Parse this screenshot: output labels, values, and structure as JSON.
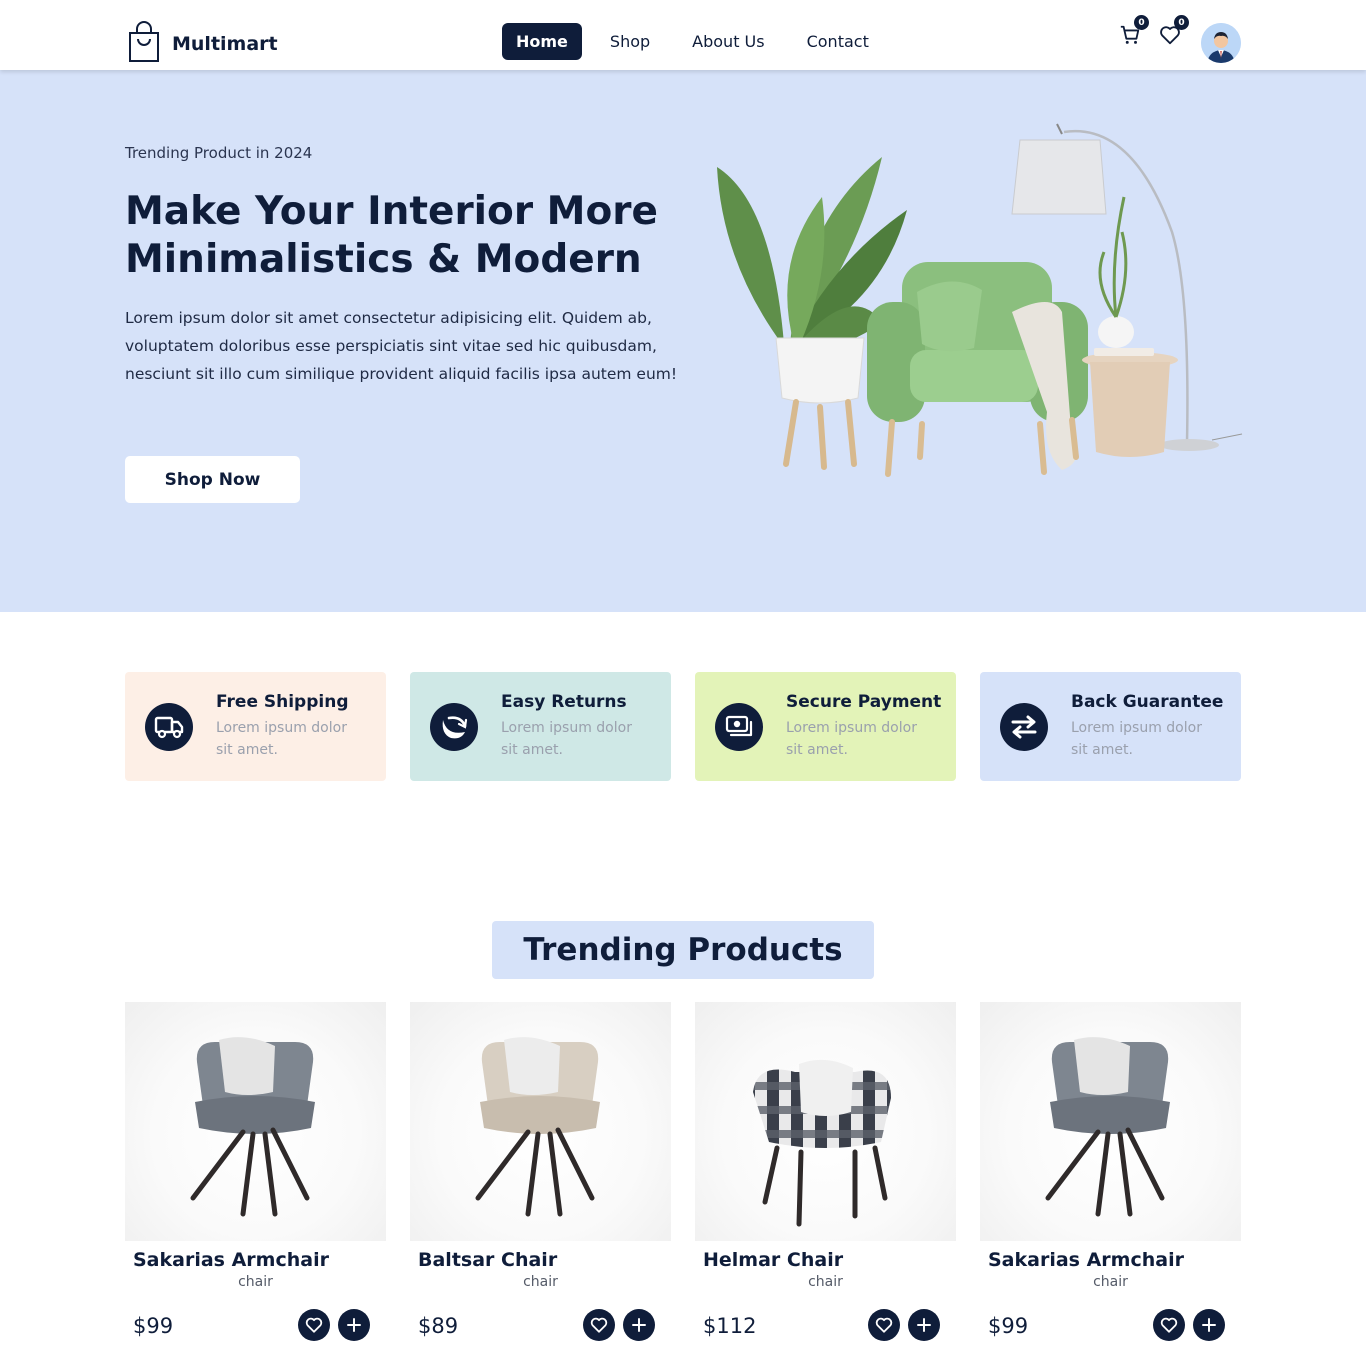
{
  "brand": {
    "name": "Multimart"
  },
  "nav": {
    "links": [
      {
        "label": "Home",
        "active": true
      },
      {
        "label": "Shop",
        "active": false
      },
      {
        "label": "About Us",
        "active": false
      },
      {
        "label": "Contact",
        "active": false
      }
    ],
    "cart_count": "0",
    "wishlist_count": "0"
  },
  "hero": {
    "eyebrow": "Trending Product in 2024",
    "title": "Make Your Interior More Minimalistics & Modern",
    "description": "Lorem ipsum dolor sit amet consectetur adipisicing elit. Quidem ab, voluptatem doloribus esse perspiciatis sint vitae sed hic quibusdam, nesciunt sit illo cum similique provident aliquid facilis ipsa autem eum!",
    "cta_label": "Shop Now",
    "background": "#d6e2f9"
  },
  "services": [
    {
      "title": "Free Shipping",
      "text": "Lorem ipsum dolor sit amet.",
      "bg": "#fdefe6",
      "icon": "truck-icon"
    },
    {
      "title": "Easy Returns",
      "text": "Lorem ipsum dolor sit amet.",
      "bg": "#cfe8e6",
      "icon": "return-arrow-icon"
    },
    {
      "title": "Secure Payment",
      "text": "Lorem ipsum dolor sit amet.",
      "bg": "#e3f3b8",
      "icon": "money-icon"
    },
    {
      "title": "Back Guarantee",
      "text": "Lorem ipsum dolor sit amet.",
      "bg": "#d6e2f9",
      "icon": "exchange-icon"
    }
  ],
  "trending": {
    "title": "Trending Products",
    "products": [
      {
        "name": "Sakarias Armchair",
        "category": "chair",
        "price": "$99",
        "seat_color": "#7e8690"
      },
      {
        "name": "Baltsar Chair",
        "category": "chair",
        "price": "$89",
        "seat_color": "#d8cfc2"
      },
      {
        "name": "Helmar Chair",
        "category": "chair",
        "price": "$112",
        "seat_color": "#3a3f4a"
      },
      {
        "name": "Sakarias Armchair",
        "category": "chair",
        "price": "$99",
        "seat_color": "#7e8690"
      }
    ]
  },
  "colors": {
    "navy": "#0f1d3a",
    "accent_blue": "#d6e2f9"
  }
}
